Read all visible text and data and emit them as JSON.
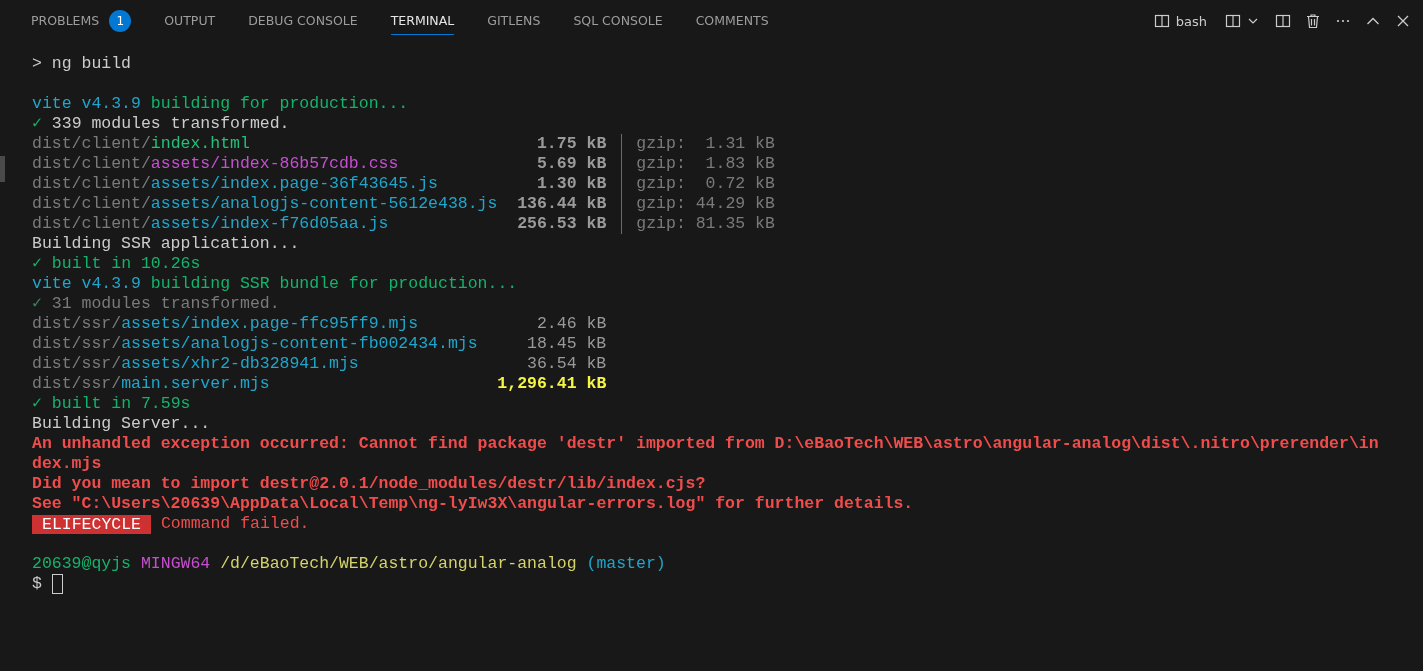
{
  "tabs": [
    {
      "label": "PROBLEMS",
      "selected": false,
      "badge": "1"
    },
    {
      "label": "OUTPUT",
      "selected": false
    },
    {
      "label": "DEBUG CONSOLE",
      "selected": false
    },
    {
      "label": "TERMINAL",
      "selected": true
    },
    {
      "label": "GITLENS",
      "selected": false
    },
    {
      "label": "SQL CONSOLE",
      "selected": false
    },
    {
      "label": "COMMENTS",
      "selected": false
    }
  ],
  "toolbar": {
    "shell": "bash"
  },
  "terminal": [
    {
      "kind": "text",
      "segments": [
        {
          "kind": "plain",
          "text": "> ng build"
        }
      ]
    },
    {
      "kind": "blank"
    },
    {
      "kind": "text",
      "segments": [
        {
          "kind": "cyan",
          "text": "vite v4.3.9 "
        },
        {
          "kind": "green",
          "text": "building for production..."
        }
      ]
    },
    {
      "kind": "text",
      "segments": [
        {
          "kind": "green",
          "text": "✓ "
        },
        {
          "kind": "plain",
          "text": "339 modules transformed."
        }
      ]
    },
    {
      "kind": "asset",
      "dir": "dist/client/",
      "file": {
        "kind": "html",
        "text": "index.html"
      },
      "size": {
        "kind": "bold",
        "text": "1.75 kB"
      },
      "gzip": "gzip:  1.31 kB"
    },
    {
      "kind": "asset",
      "dir": "dist/client/",
      "file": {
        "kind": "css",
        "text": "assets/index-86b57cdb.css"
      },
      "size": {
        "kind": "bold",
        "text": "5.69 kB"
      },
      "gzip": "gzip:  1.83 kB"
    },
    {
      "kind": "asset",
      "dir": "dist/client/",
      "file": {
        "kind": "js",
        "text": "assets/index.page-36f43645.js"
      },
      "size": {
        "kind": "bold",
        "text": "1.30 kB"
      },
      "gzip": "gzip:  0.72 kB"
    },
    {
      "kind": "asset",
      "dir": "dist/client/",
      "file": {
        "kind": "js",
        "text": "assets/analogjs-content-5612e438.js"
      },
      "size": {
        "kind": "bold",
        "text": "136.44 kB"
      },
      "gzip": "gzip: 44.29 kB"
    },
    {
      "kind": "asset",
      "dir": "dist/client/",
      "file": {
        "kind": "js",
        "text": "assets/index-f76d05aa.js"
      },
      "size": {
        "kind": "bold",
        "text": "256.53 kB"
      },
      "gzip": "gzip: 81.35 kB"
    },
    {
      "kind": "text",
      "segments": [
        {
          "kind": "plain",
          "text": "Building SSR application..."
        }
      ]
    },
    {
      "kind": "text",
      "segments": [
        {
          "kind": "green",
          "text": "✓ built in 10.26s"
        }
      ]
    },
    {
      "kind": "text",
      "segments": [
        {
          "kind": "cyan",
          "text": "vite v4.3.9 "
        },
        {
          "kind": "green",
          "text": "building SSR bundle for production..."
        }
      ]
    },
    {
      "kind": "text",
      "segments": [
        {
          "kind": "dimgreen",
          "text": "✓ "
        },
        {
          "kind": "dim",
          "text": "31 modules transformed."
        }
      ]
    },
    {
      "kind": "asset",
      "dir": "dist/ssr/",
      "file": {
        "kind": "js",
        "text": "assets/index.page-ffc95ff9.mjs"
      },
      "size": {
        "kind": "normal",
        "text": "2.46 kB"
      }
    },
    {
      "kind": "asset",
      "dir": "dist/ssr/",
      "file": {
        "kind": "js",
        "text": "assets/analogjs-content-fb002434.mjs"
      },
      "size": {
        "kind": "normal",
        "text": "18.45 kB"
      }
    },
    {
      "kind": "asset",
      "dir": "dist/ssr/",
      "file": {
        "kind": "js",
        "text": "assets/xhr2-db328941.mjs"
      },
      "size": {
        "kind": "normal",
        "text": "36.54 kB"
      }
    },
    {
      "kind": "asset",
      "dir": "dist/ssr/",
      "file": {
        "kind": "js",
        "text": "main.server.mjs"
      },
      "size": {
        "kind": "warn",
        "text": "1,296.41 kB"
      }
    },
    {
      "kind": "text",
      "segments": [
        {
          "kind": "green",
          "text": "✓ built in 7.59s"
        }
      ]
    },
    {
      "kind": "text",
      "segments": [
        {
          "kind": "plain",
          "text": "Building Server..."
        }
      ]
    },
    {
      "kind": "text",
      "segments": [
        {
          "kind": "error",
          "text": "An unhandled exception occurred: Cannot find package 'destr' imported from D:\\eBaoTech\\WEB\\astro\\angular-analog\\dist\\.nitro\\prerender\\index.mjs"
        }
      ]
    },
    {
      "kind": "text",
      "segments": [
        {
          "kind": "error",
          "text": "Did you mean to import destr@2.0.1/node_modules/destr/lib/index.cjs?"
        }
      ]
    },
    {
      "kind": "text",
      "segments": [
        {
          "kind": "error",
          "text": "See \"C:\\Users\\20639\\AppData\\Local\\Temp\\ng-lyIw3X\\angular-errors.log\" for further details."
        }
      ]
    },
    {
      "kind": "text",
      "segments": [
        {
          "kind": "badge",
          "text": "ELIFECYCLE"
        },
        {
          "kind": "failed",
          "text": " Command failed."
        }
      ]
    },
    {
      "kind": "blank"
    },
    {
      "kind": "text",
      "segments": [
        {
          "kind": "green",
          "text": "20639@qyjs "
        },
        {
          "kind": "magenta",
          "text": "MINGW64 "
        },
        {
          "kind": "path",
          "text": "/d/eBaoTech/WEB/astro/angular-analog "
        },
        {
          "kind": "cyan",
          "text": "(master)"
        }
      ]
    },
    {
      "kind": "input",
      "segments": [
        {
          "kind": "plain",
          "text": "$ "
        }
      ]
    }
  ]
}
